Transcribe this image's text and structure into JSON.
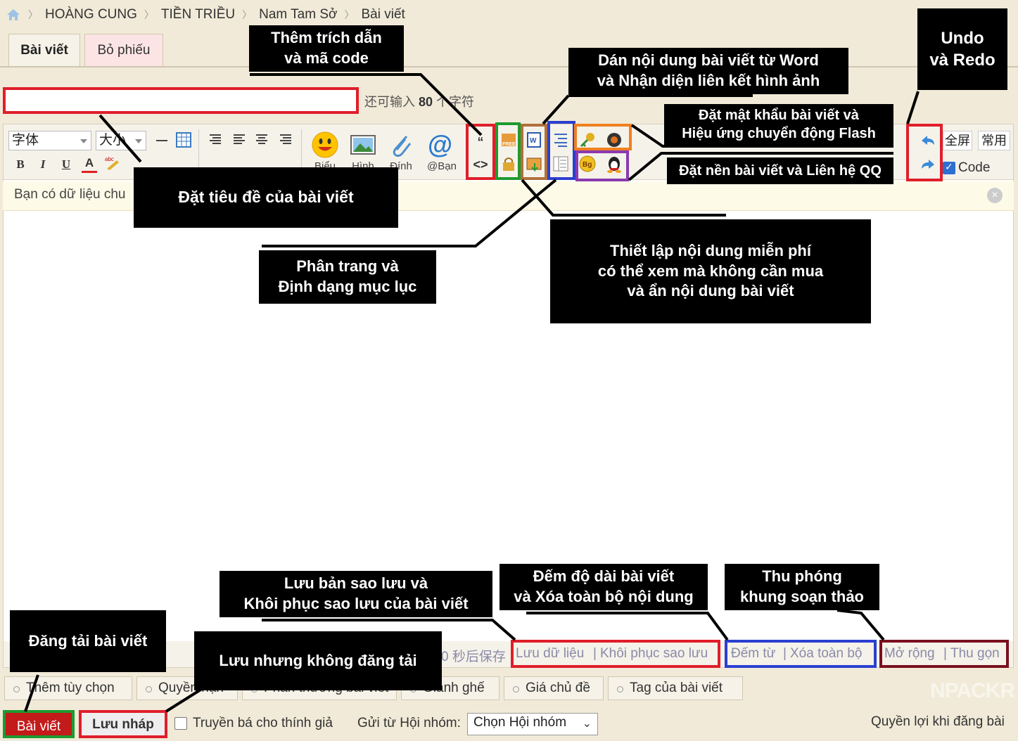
{
  "breadcrumb": {
    "items": [
      "HOÀNG CUNG",
      "TIỀN TRIỀU",
      "Nam Tam Sở",
      "Bài viết"
    ]
  },
  "tabs": [
    {
      "label": "Bài viết"
    },
    {
      "label": "Bỏ phiếu"
    }
  ],
  "title_field": {
    "value": "",
    "hint_prefix": "还可输入",
    "hint_count": "80",
    "hint_suffix": "个字符"
  },
  "toolbar": {
    "font_select": "字体",
    "size_select": "大小",
    "bold": "B",
    "italic": "I",
    "underline": "U",
    "color": "A",
    "big_icons": [
      {
        "label": "Biểu",
        "icon": "smiley-icon"
      },
      {
        "label": "Hình",
        "icon": "image-icon"
      },
      {
        "label": "Đính",
        "icon": "paperclip-icon"
      },
      {
        "label": "@Bạn",
        "icon": "at-icon"
      }
    ],
    "fullscreen": "全屏",
    "common": "常用",
    "code_label": "Code",
    "code_checked": true
  },
  "notice": {
    "text": "Bạn có dữ liệu chu"
  },
  "status_bar": {
    "autosave": "0 秒后保存",
    "save_data": "Lưu dữ liệu",
    "restore": "Khôi phục sao lưu",
    "count_words": "Đếm từ",
    "clear_all": "Xóa toàn bộ",
    "expand": "Mở rộng",
    "collapse": "Thu gọn",
    "separator": "|"
  },
  "options": [
    {
      "label": "Thêm tùy chọn"
    },
    {
      "label": "Quyền hạn"
    },
    {
      "label": "Phần thưởng bài viết"
    },
    {
      "label": "Giành ghế"
    },
    {
      "label": "Giá chủ đề"
    },
    {
      "label": "Tag của bài viết"
    }
  ],
  "footer": {
    "post_button": "Bài viết",
    "draft_button": "Lưu nháp",
    "spread_label": "Truyền bá cho thính giả",
    "send_from_label": "Gửi từ Hội nhóm:",
    "group_select": "Chọn Hội nhóm",
    "rights_link": "Quyền lợi khi đăng bài"
  },
  "annotations": {
    "quote_code": "Thêm trích dẫn\nvà mã code",
    "paste_word": "Dán nội dung bài viết từ Word\nvà Nhận diện liên kết hình ảnh",
    "undo_redo": "Undo\nvà Redo",
    "password_flash": "Đặt mật khẩu bài viết và\nHiệu ứng chuyển động Flash",
    "background_qq": "Đặt nền bài viết và Liên hệ QQ",
    "set_title": "Đặt tiêu đề của bài viết",
    "page_toc": "Phân trang và\nĐịnh dạng mục lục",
    "free_hide": "Thiết lập nội dung miễn phí\ncó thể xem mà không cần mua\nvà ẩn nội dung bài viết",
    "backup": "Lưu bản sao lưu và\nKhôi phục sao lưu của bài viết",
    "count_clear": "Đếm độ dài bài viết\nvà Xóa toàn bộ nội dung",
    "zoom": "Thu phóng\nkhung soạn thảo",
    "publish": "Đăng tải bài viết",
    "save_no_publish": "Lưu nhưng không đăng tải"
  },
  "watermark": "NPACKR",
  "colors": {
    "red": "#e01e2a",
    "green": "#1e9a2e",
    "brown": "#b0703a",
    "blue": "#2a3fd0",
    "orange": "#f08020",
    "purple": "#8a3ab0",
    "darkred": "#7a1020",
    "post_button": "#c31a1a"
  }
}
